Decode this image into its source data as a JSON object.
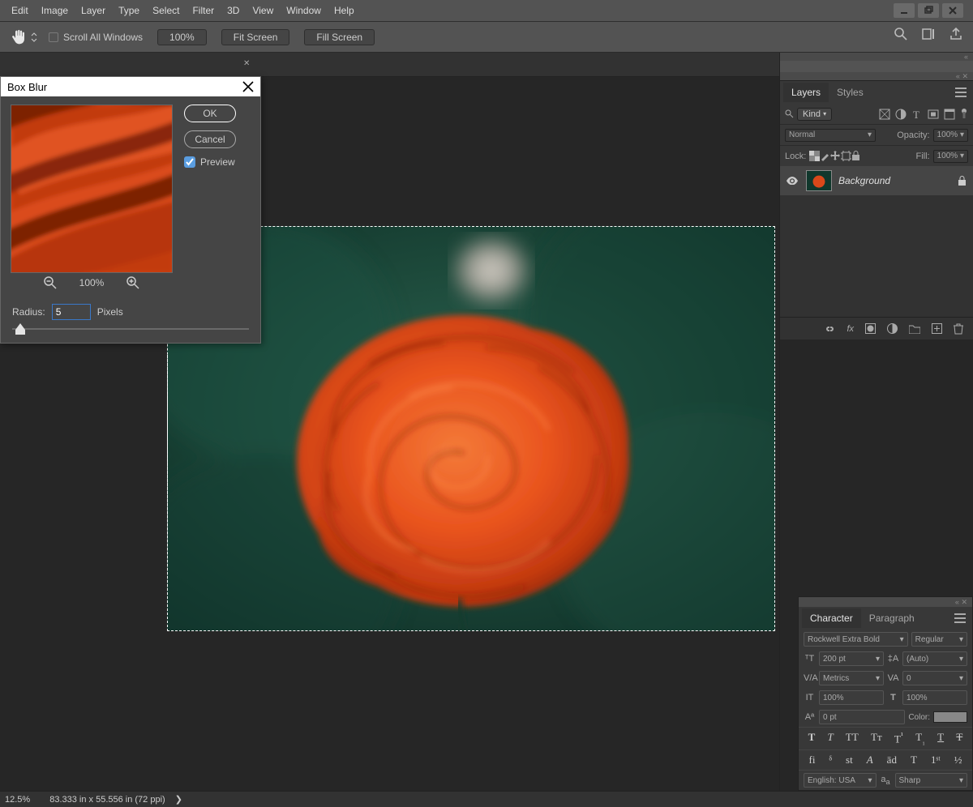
{
  "menu": {
    "items": [
      "Edit",
      "Image",
      "Layer",
      "Type",
      "Select",
      "Filter",
      "3D",
      "View",
      "Window",
      "Help"
    ]
  },
  "options": {
    "scroll_all": "Scroll All Windows",
    "zoom": "100%",
    "fit": "Fit Screen",
    "fill": "Fill Screen"
  },
  "dialog": {
    "title": "Box Blur",
    "ok": "OK",
    "cancel": "Cancel",
    "preview": "Preview",
    "zoom": "100%",
    "radius_label": "Radius:",
    "radius_value": "5",
    "radius_unit": "Pixels"
  },
  "layers": {
    "tabs": [
      "Layers",
      "Styles"
    ],
    "kind": "Kind",
    "blend": "Normal",
    "opacity_label": "Opacity:",
    "opacity": "100%",
    "lock_label": "Lock:",
    "fill_label": "Fill:",
    "fill": "100%",
    "item": "Background"
  },
  "char": {
    "tabs": [
      "Character",
      "Paragraph"
    ],
    "font": "Rockwell Extra Bold",
    "weight": "Regular",
    "size": "200 pt",
    "leading": "(Auto)",
    "kerning": "Metrics",
    "tracking": "0",
    "vscale": "100%",
    "hscale": "100%",
    "baseline": "0 pt",
    "color_label": "Color:",
    "lang": "English: USA",
    "aa": "Sharp"
  },
  "status": {
    "zoom": "12.5%",
    "info": "83.333 in x 55.556 in (72 ppi)",
    "chev": "❯"
  }
}
